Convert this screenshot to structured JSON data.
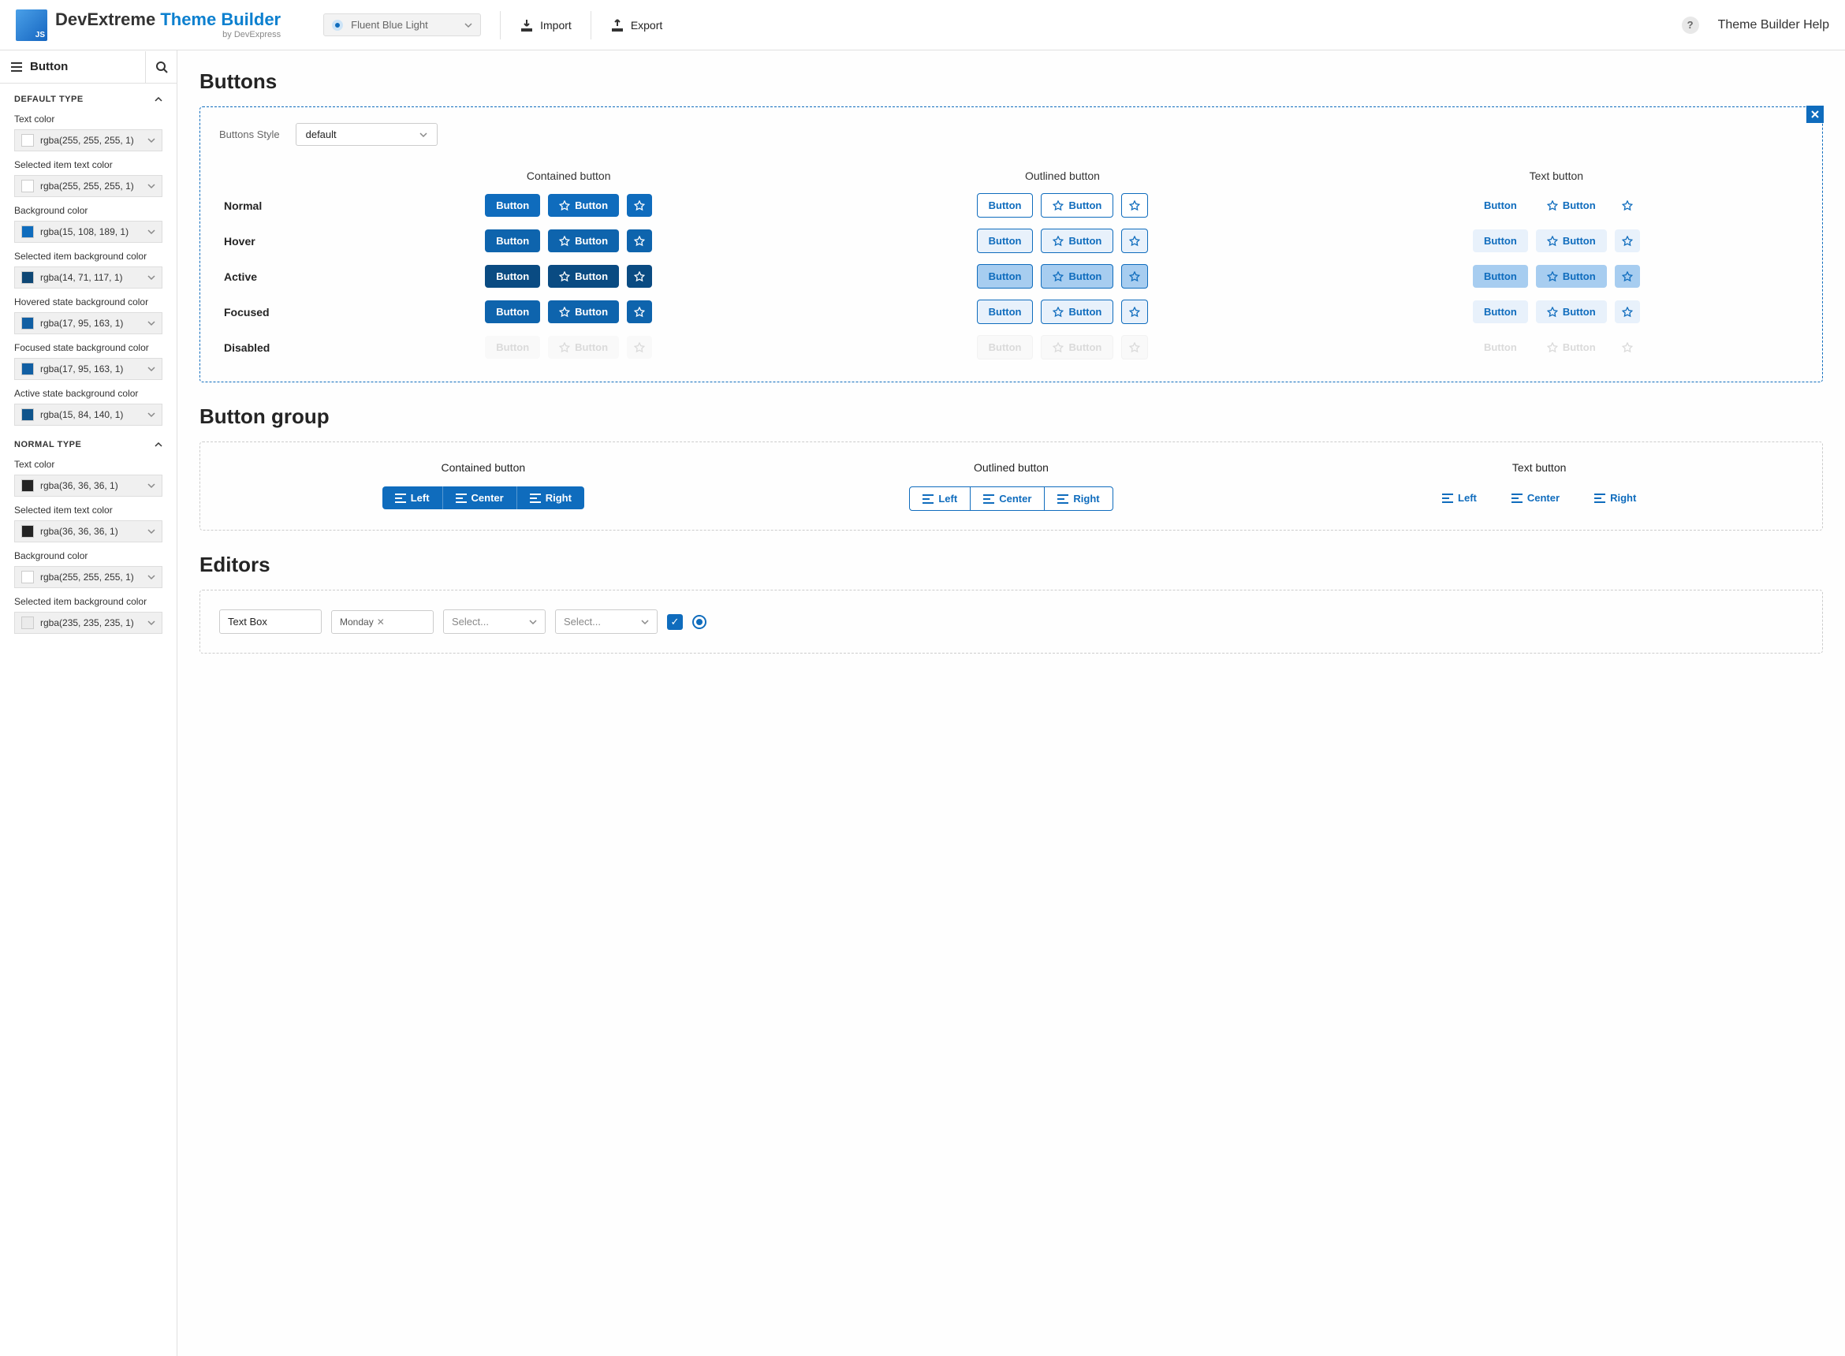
{
  "header": {
    "product": "DevExtreme",
    "product_suffix": "Theme Builder",
    "by": "by DevExpress",
    "theme_name": "Fluent Blue Light",
    "import": "Import",
    "export": "Export",
    "help_link": "Theme Builder Help"
  },
  "sidebar": {
    "title": "Button",
    "sections": [
      {
        "title": "DEFAULT TYPE",
        "props": [
          {
            "label": "Text color",
            "value": "rgba(255, 255, 255, 1)",
            "swatch": "#ffffff"
          },
          {
            "label": "Selected item text color",
            "value": "rgba(255, 255, 255, 1)",
            "swatch": "#ffffff"
          },
          {
            "label": "Background color",
            "value": "rgba(15, 108, 189, 1)",
            "swatch": "#0f6cbd"
          },
          {
            "label": "Selected item background color",
            "value": "rgba(14, 71, 117, 1)",
            "swatch": "#0e4775"
          },
          {
            "label": "Hovered state background color",
            "value": "rgba(17, 95, 163, 1)",
            "swatch": "#115fa3"
          },
          {
            "label": "Focused state background color",
            "value": "rgba(17, 95, 163, 1)",
            "swatch": "#115fa3"
          },
          {
            "label": "Active state background color",
            "value": "rgba(15, 84, 140, 1)",
            "swatch": "#0f548c"
          }
        ]
      },
      {
        "title": "NORMAL TYPE",
        "props": [
          {
            "label": "Text color",
            "value": "rgba(36, 36, 36, 1)",
            "swatch": "#242424"
          },
          {
            "label": "Selected item text color",
            "value": "rgba(36, 36, 36, 1)",
            "swatch": "#242424"
          },
          {
            "label": "Background color",
            "value": "rgba(255, 255, 255, 1)",
            "swatch": "#ffffff"
          },
          {
            "label": "Selected item background color",
            "value": "rgba(235, 235, 235, 1)",
            "swatch": "#ebebeb"
          }
        ]
      }
    ]
  },
  "main": {
    "buttons_heading": "Buttons",
    "style_label": "Buttons Style",
    "style_value": "default",
    "columns": [
      "Contained button",
      "Outlined button",
      "Text button"
    ],
    "rows": [
      "Normal",
      "Hover",
      "Active",
      "Focused",
      "Disabled"
    ],
    "button_label": "Button",
    "group_heading": "Button group",
    "group_columns": [
      "Contained button",
      "Outlined button",
      "Text button"
    ],
    "group_items": [
      "Left",
      "Center",
      "Right"
    ],
    "editors_heading": "Editors",
    "editors": {
      "textbox": "Text Box",
      "tag": "Monday",
      "select_placeholder": "Select..."
    }
  }
}
